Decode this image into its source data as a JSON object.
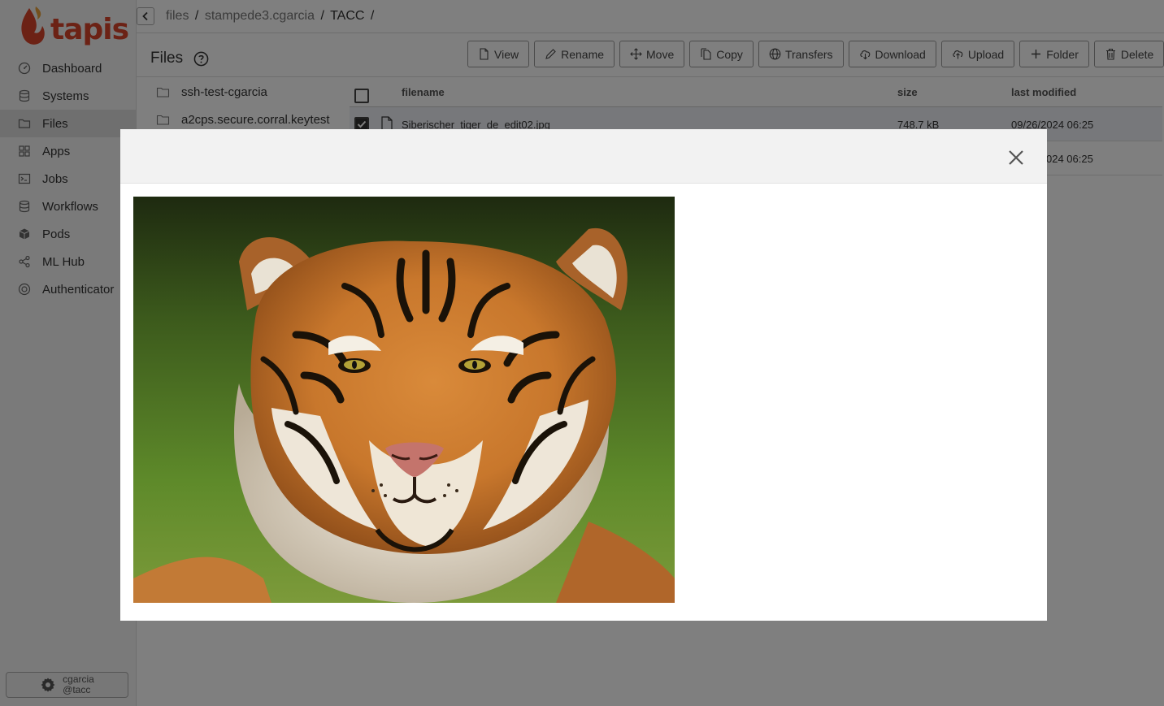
{
  "app": {
    "logo_text": "tapis"
  },
  "sidebar": {
    "items": [
      {
        "label": "Dashboard",
        "icon": "dashboard-icon",
        "active": false
      },
      {
        "label": "Systems",
        "icon": "database-icon",
        "active": false
      },
      {
        "label": "Files",
        "icon": "folder-icon",
        "active": true
      },
      {
        "label": "Apps",
        "icon": "grid-icon",
        "active": false
      },
      {
        "label": "Jobs",
        "icon": "terminal-icon",
        "active": false
      },
      {
        "label": "Workflows",
        "icon": "workflows-icon",
        "active": false
      },
      {
        "label": "Pods",
        "icon": "cube-icon",
        "active": false
      },
      {
        "label": "ML Hub",
        "icon": "share-icon",
        "active": false
      },
      {
        "label": "Authenticator",
        "icon": "shield-icon",
        "active": false
      }
    ],
    "user": {
      "name": "cgarcia",
      "tenant": "@tacc"
    }
  },
  "breadcrumb": {
    "part1": "files",
    "part2": "stampede3.cgarcia",
    "part3": "TACC",
    "sep": "/"
  },
  "files_header": {
    "title": "Files"
  },
  "toolbar": {
    "view": "View",
    "rename": "Rename",
    "move": "Move",
    "copy": "Copy",
    "transfers": "Transfers",
    "download": "Download",
    "upload": "Upload",
    "folder": "Folder",
    "delete": "Delete"
  },
  "folders": [
    "ssh-test-cgarcia",
    "a2cps.secure.corral.keytest"
  ],
  "table": {
    "headers": {
      "name": "filename",
      "size": "size",
      "modified": "last modified"
    },
    "rows": [
      {
        "name": "Siberischer_tiger_de_edit02.jpg",
        "size": "748.7 kB",
        "modified": "09/26/2024 06:25",
        "selected": true
      },
      {
        "name": "",
        "size": "",
        "modified": "024 06:25",
        "selected": false
      }
    ]
  },
  "colors": {
    "brand": "#d8442a",
    "sidebar_bg": "#f4f4f4",
    "overlay": "rgba(0,0,0,0.5)"
  }
}
